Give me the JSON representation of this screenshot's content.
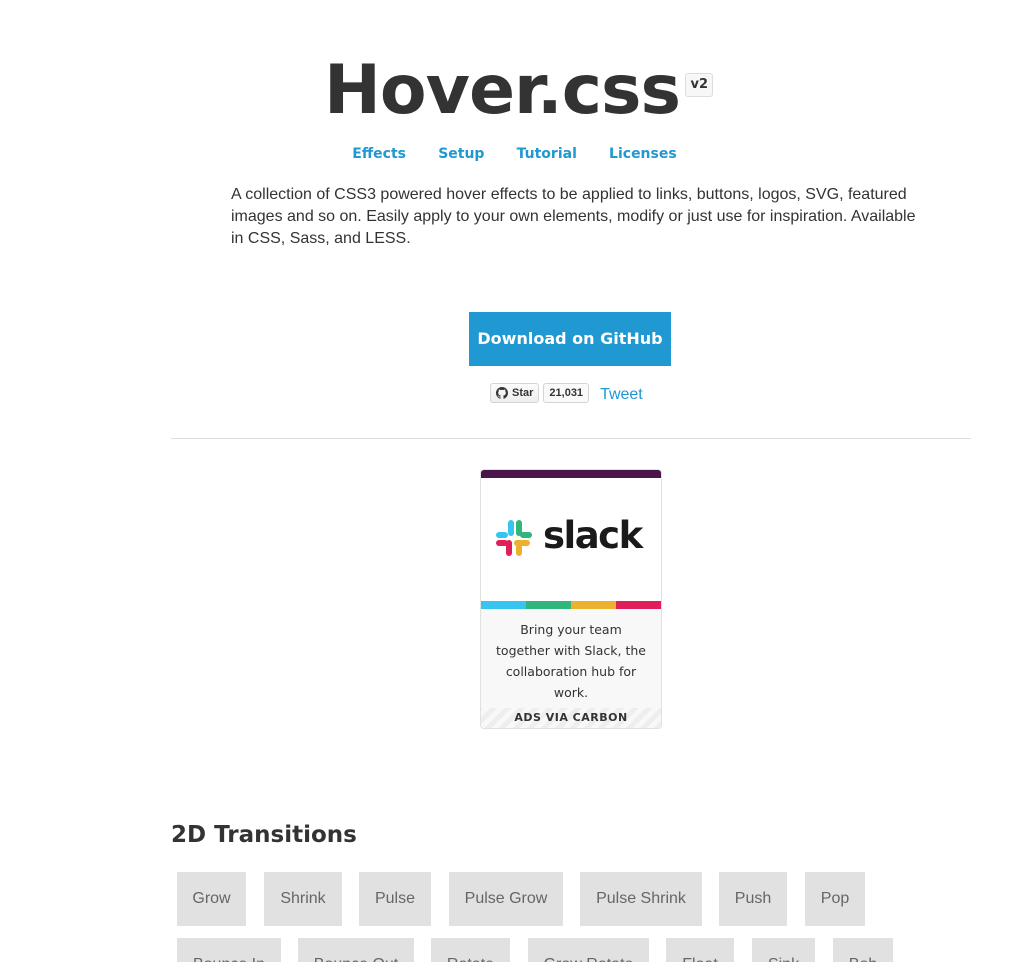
{
  "header": {
    "title": "Hover.css",
    "version": "v2"
  },
  "nav": {
    "items": [
      {
        "label": "Effects"
      },
      {
        "label": "Setup"
      },
      {
        "label": "Tutorial"
      },
      {
        "label": "Licenses"
      }
    ]
  },
  "intro": {
    "description": "A collection of CSS3 powered hover effects to be applied to links, buttons, logos, SVG, featured images and so on. Easily apply to your own elements, modify or just use for inspiration. Available in CSS, Sass, and LESS."
  },
  "download": {
    "label": "Download on GitHub"
  },
  "social": {
    "star_label": "Star",
    "star_count": "21,031",
    "tweet_label": "Tweet"
  },
  "ad": {
    "brand": "slack",
    "text": "Bring your team together with Slack, the collaboration hub for work.",
    "footer": "ADS VIA CARBON",
    "colors": {
      "topbar": "#4a154b",
      "stripes": [
        "#36c5f0",
        "#2eb67d",
        "#ecb22e",
        "#e01e5a"
      ]
    }
  },
  "section": {
    "title": "2D Transitions",
    "effects_row1": [
      "Grow",
      "Shrink",
      "Pulse",
      "Pulse Grow",
      "Pulse Shrink",
      "Push",
      "Pop"
    ],
    "effects_row2": [
      "Bounce In",
      "Bounce Out",
      "Rotate",
      "Grow Rotate",
      "Float",
      "Sink",
      "Bob"
    ]
  },
  "colors": {
    "accent": "#2098d1",
    "text": "#333333",
    "effect_bg": "#e1e1e1",
    "effect_text": "#666666"
  }
}
